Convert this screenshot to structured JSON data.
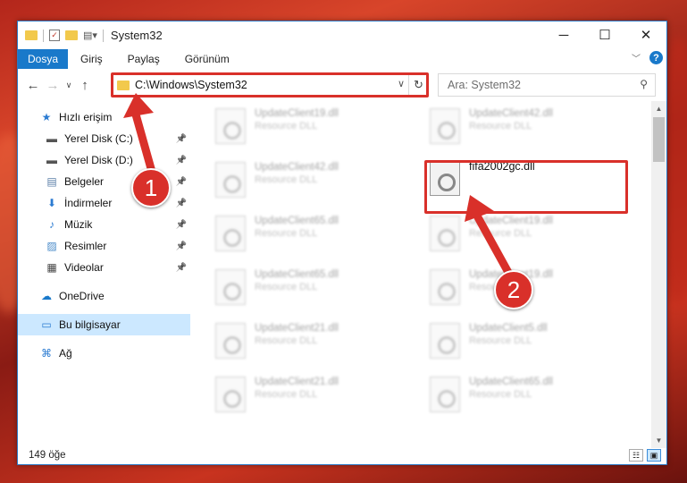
{
  "window": {
    "title": "System32",
    "controls": {
      "minimize": "─",
      "maximize": "☐",
      "close": "✕"
    }
  },
  "ribbon": {
    "tabs": [
      "Dosya",
      "Giriş",
      "Paylaş",
      "Görünüm"
    ]
  },
  "address_bar": {
    "path": "C:\\Windows\\System32",
    "refresh": "↻"
  },
  "search": {
    "placeholder": "Ara: System32"
  },
  "sidebar": {
    "items": [
      {
        "label": "Hızlı erişim",
        "icon": "star-icon",
        "pinned": false
      },
      {
        "label": "Yerel Disk (C:)",
        "icon": "drive-icon",
        "pinned": true
      },
      {
        "label": "Yerel Disk (D:)",
        "icon": "drive-icon",
        "pinned": true
      },
      {
        "label": "Belgeler",
        "icon": "document-icon",
        "pinned": true
      },
      {
        "label": "İndirmeler",
        "icon": "download-icon",
        "pinned": true
      },
      {
        "label": "Müzik",
        "icon": "music-icon",
        "pinned": true
      },
      {
        "label": "Resimler",
        "icon": "pictures-icon",
        "pinned": true
      },
      {
        "label": "Videolar",
        "icon": "video-icon",
        "pinned": true
      },
      {
        "label": "OneDrive",
        "icon": "cloud-icon",
        "pinned": false
      },
      {
        "label": "Bu bilgisayar",
        "icon": "computer-icon",
        "pinned": false,
        "selected": true
      },
      {
        "label": "Ağ",
        "icon": "network-icon",
        "pinned": false
      }
    ]
  },
  "files": {
    "left": [
      {
        "name": "UpdateClient19.dll",
        "type": "Resource DLL"
      },
      {
        "name": "UpdateClient42.dll",
        "type": "Resource DLL"
      },
      {
        "name": "UpdateClient65.dll",
        "type": "Resource DLL"
      },
      {
        "name": "UpdateClient65.dll",
        "type": "Resource DLL"
      },
      {
        "name": "UpdateClient21.dll",
        "type": "Resource DLL"
      },
      {
        "name": "UpdateClient21.dll",
        "type": "Resource DLL"
      }
    ],
    "right": [
      {
        "name": "UpdateClient42.dll",
        "type": "Resource DLL"
      },
      {
        "name": "fifa2002gc.dll",
        "type": ""
      },
      {
        "name": "UpdateClient19.dll",
        "type": "Resource DLL"
      },
      {
        "name": "UpdateClient19.dll",
        "type": "Resource DLL"
      },
      {
        "name": "UpdateClient5.dll",
        "type": "Resource DLL"
      },
      {
        "name": "UpdateClient65.dll",
        "type": "Resource DLL"
      }
    ]
  },
  "status": {
    "item_count": "149 öğe"
  },
  "annotations": {
    "badge_1": "1",
    "badge_2": "2",
    "highlight_color": "#d9302a"
  }
}
